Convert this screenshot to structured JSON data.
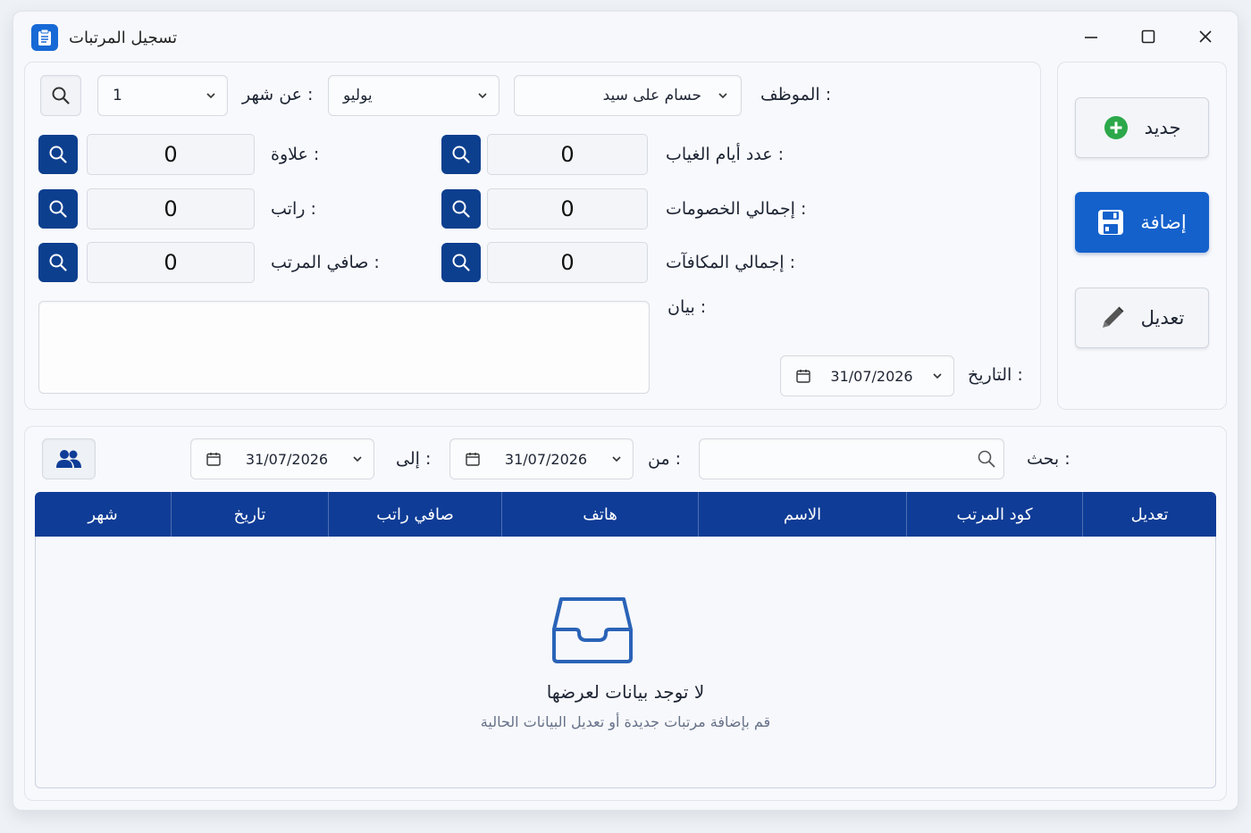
{
  "window": {
    "title": "تسجيل المرتبات"
  },
  "form": {
    "employee_label": "الموظف :",
    "employee_value": "حسام على سيد",
    "month_label": "عن شهر :",
    "month_value": "يوليو",
    "month_number": "1",
    "absence_days_label": "عدد أيام الغياب :",
    "absence_days_value": "0",
    "total_deductions_label": "إجمالي الخصومات :",
    "total_deductions_value": "0",
    "total_bonuses_label": "إجمالي المكافآت :",
    "total_bonuses_value": "0",
    "allowance_label": "علاوة :",
    "allowance_value": "0",
    "salary_label": "راتب :",
    "salary_value": "0",
    "net_salary_label": "صافي المرتب :",
    "net_salary_value": "0",
    "notes_label": "بيان :",
    "notes_value": "",
    "date_label": "التاريخ :",
    "date_value": "31/07/2026"
  },
  "actions": {
    "new_label": "جديد",
    "add_label": "إضافة",
    "edit_label": "تعديل"
  },
  "filter": {
    "search_label": "بحث :",
    "search_value": "",
    "from_label": "من :",
    "from_date": "31/07/2026",
    "to_label": "إلى :",
    "to_date": "31/07/2026"
  },
  "table": {
    "columns": [
      "تعديل",
      "كود المرتب",
      "الاسم",
      "هاتف",
      "صافي راتب",
      "تاريخ",
      "شهر"
    ],
    "rows": [],
    "empty_title": "لا توجد بيانات لعرضها",
    "empty_subtitle": "قم بإضافة مرتبات جديدة أو تعديل البيانات الحالية"
  },
  "colors": {
    "primary": "#1461cc",
    "header": "#0f3c96",
    "search_button": "#0d3f8f",
    "add_icon": "#2ca84a",
    "empty_icon": "#2a63b8"
  },
  "icons": {
    "app": "clipboard-icon",
    "minimize": "minimize-icon",
    "maximize": "maximize-icon",
    "close": "close-icon",
    "search": "search-icon",
    "calendar": "calendar-icon",
    "chevron": "chevron-down-icon",
    "plus": "plus-circle-icon",
    "save": "floppy-disk-icon",
    "pencil": "pencil-icon",
    "users": "users-icon",
    "inbox": "inbox-icon"
  }
}
